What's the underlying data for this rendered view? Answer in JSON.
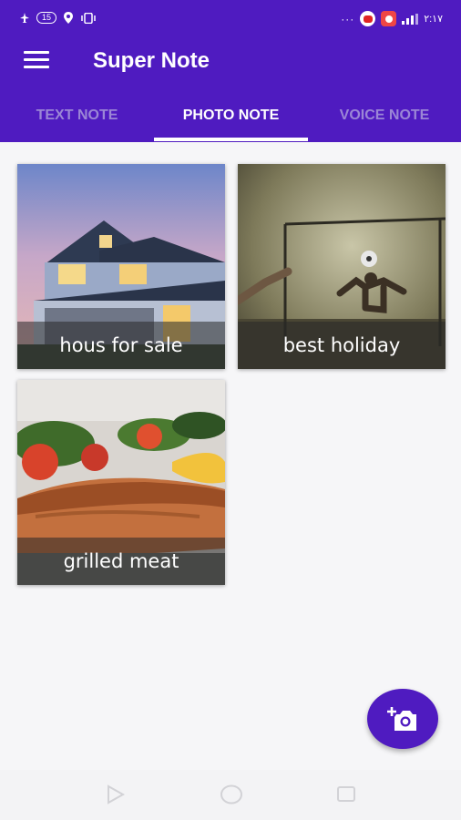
{
  "status_bar": {
    "left_badge": "15",
    "time": "٢:١٧"
  },
  "app": {
    "title": "Super Note",
    "menu_icon": "hamburger-menu-icon"
  },
  "tabs": [
    {
      "label": "TEXT NOTE",
      "active": false
    },
    {
      "label": "PHOTO NOTE",
      "active": true
    },
    {
      "label": "VOICE NOTE",
      "active": false
    }
  ],
  "notes": [
    {
      "caption": "hous for sale",
      "image": "house-photo"
    },
    {
      "caption": "best holiday",
      "image": "football-photo"
    },
    {
      "caption": "grilled meat",
      "image": "food-photo"
    }
  ],
  "fab": {
    "icon": "add-photo-camera-icon"
  },
  "colors": {
    "primary": "#4f1bc0",
    "tab_inactive": "#9b86d6",
    "background": "#f6f6f8"
  },
  "nav_bar": {
    "icons": [
      "back-triangle-icon",
      "home-circle-icon",
      "recents-square-icon"
    ]
  }
}
